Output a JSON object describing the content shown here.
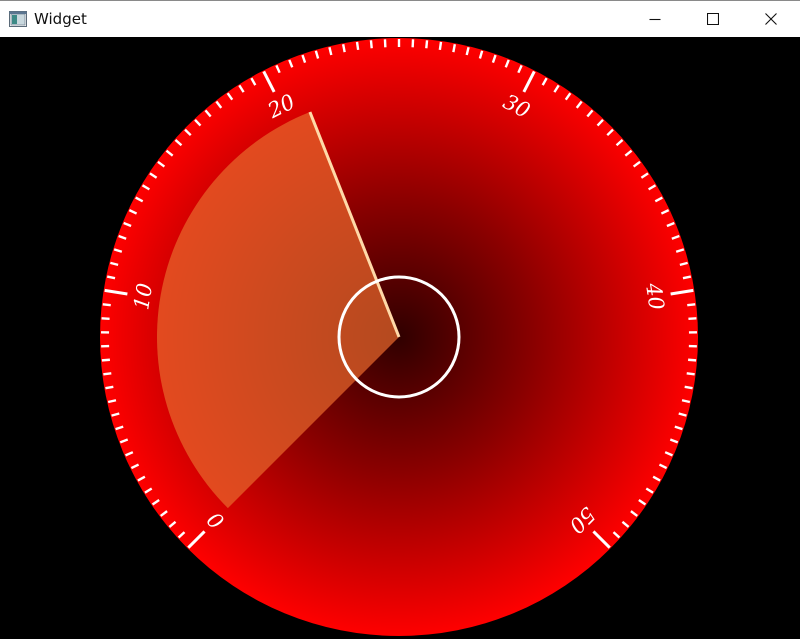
{
  "window": {
    "title": "Widget",
    "controls": {
      "minimize": "minimize",
      "maximize": "maximize",
      "close": "close"
    }
  },
  "gauge": {
    "min": 0,
    "max": 50,
    "value": 21,
    "major_step": 10,
    "minor_step": 1,
    "labels": [
      "0",
      "10",
      "20",
      "30",
      "40",
      "50"
    ],
    "colors": {
      "dial_outer": "#ff0000",
      "dial_inner": "#300000",
      "sector": "#e8672b",
      "pointer_edge": "#ffd9a8",
      "hub_ring": "#ffffff",
      "ticks": "#ffffff"
    }
  }
}
